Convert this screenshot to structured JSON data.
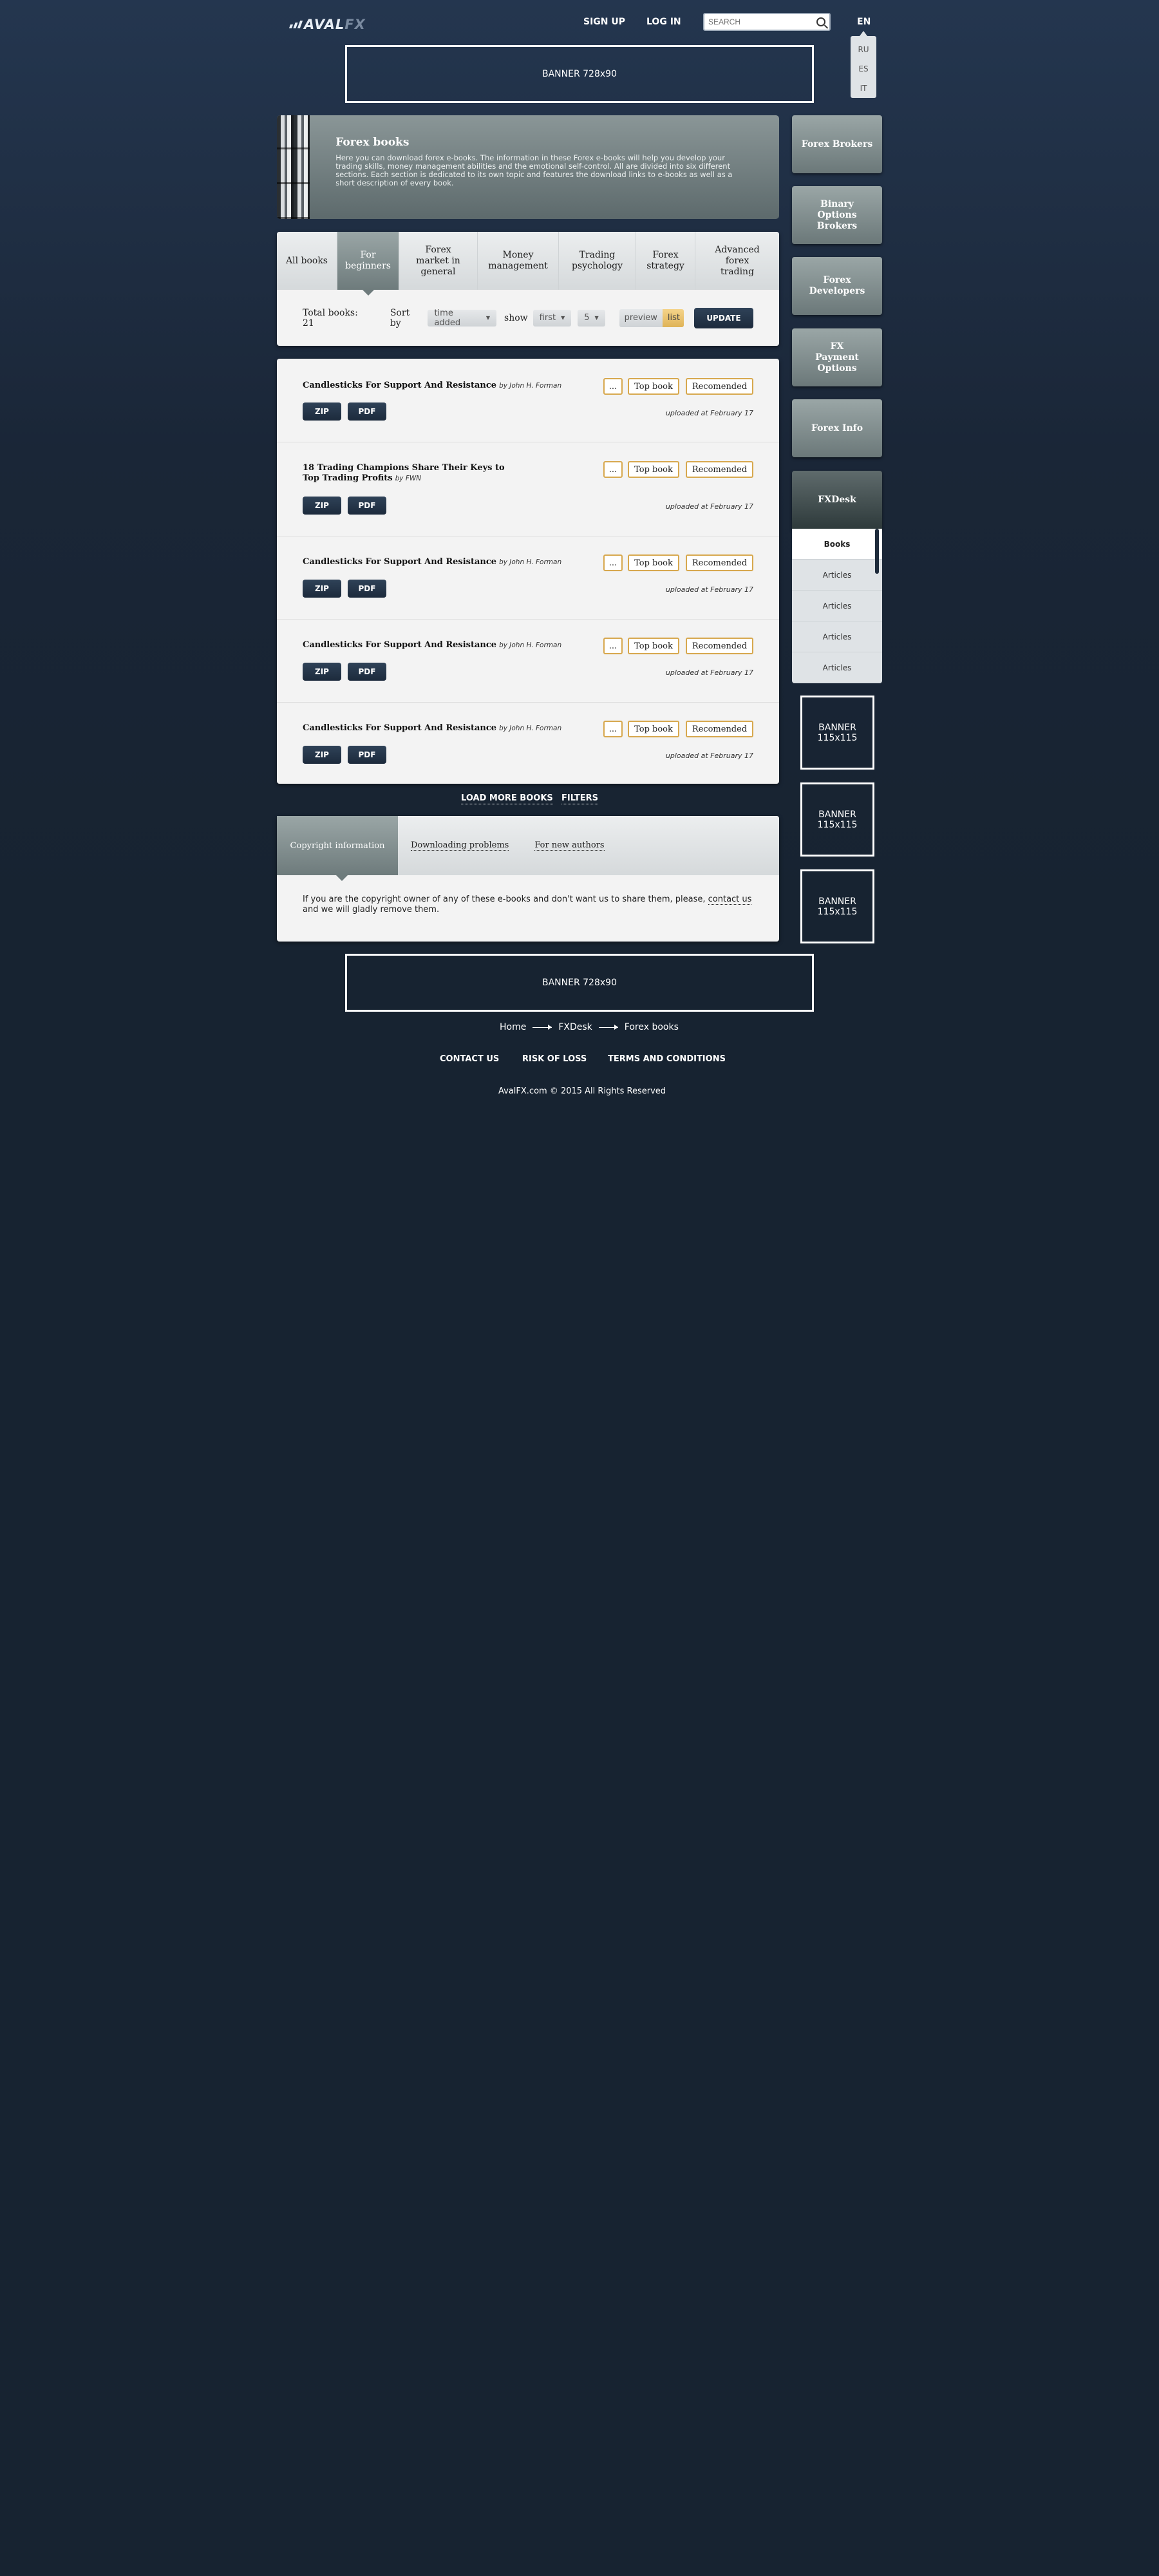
{
  "header": {
    "logo": {
      "main": "AVAL",
      "accent": "FX"
    },
    "signup": "SIGN UP",
    "login": "LOG IN",
    "search_placeholder": "SEARCH",
    "lang_current": "EN",
    "lang_options": [
      "RU",
      "ES",
      "IT"
    ]
  },
  "banners": {
    "top": "BANNER 728x90",
    "bottom": "BANNER 728x90",
    "side": [
      "BANNER\n115x115",
      "BANNER\n115x115",
      "BANNER\n115x115"
    ]
  },
  "hero": {
    "title": "Forex books",
    "text": "Here you can download forex e-books. The information in these Forex e-books will help you develop your trading skills, money management abilities and the emotional self-control. All are divided into six different sections. Each section is dedicated to its own topic and features the download links to e-books as well as a short description of every book."
  },
  "categories": [
    {
      "label": "All books",
      "active": false
    },
    {
      "label": "For beginners",
      "active": true
    },
    {
      "label": "Forex market in general",
      "active": false
    },
    {
      "label": "Money management",
      "active": false
    },
    {
      "label": "Trading psychology",
      "active": false
    },
    {
      "label": "Forex strategy",
      "active": false
    },
    {
      "label": "Advanced forex trading",
      "active": false
    }
  ],
  "controls": {
    "total_label": "Total books: 21",
    "sort_label": "Sort by",
    "sort_value": "time added",
    "show_label": "show",
    "order_value": "first",
    "count_value": "5",
    "view_preview": "preview",
    "view_list": "list",
    "update": "UPDATE"
  },
  "books": [
    {
      "title": "Candlesticks For Support And Resistance",
      "author": "by John H. Forman",
      "uploaded": "uploaded at February 17"
    },
    {
      "title": "18 Trading Champions Share Their Keys to Top Trading Profits",
      "author": "by FWN",
      "uploaded": "uploaded at February 17"
    },
    {
      "title": "Candlesticks For Support And Resistance",
      "author": "by John H. Forman",
      "uploaded": "uploaded at February 17"
    },
    {
      "title": "Candlesticks For Support And Resistance",
      "author": "by John H. Forman",
      "uploaded": "uploaded at February 17"
    },
    {
      "title": "Candlesticks For Support And Resistance",
      "author": "by John H. Forman",
      "uploaded": "uploaded at February 17"
    }
  ],
  "book_labels": {
    "zip": "ZIP",
    "pdf": "PDF",
    "more": "...",
    "top": "Top book",
    "rec": "Recomended"
  },
  "load_more": "LOAD MORE BOOKS",
  "filters": "FILTERS",
  "info_tabs": [
    "Copyright information",
    "Downloading problems",
    "For new authors"
  ],
  "copyright_text": "If you are the copyright owner of any of these e-books and don't want us to share them, please,",
  "copyright_link": "contact us",
  "copyright_text2": "and we will gladly remove them.",
  "sidebar": {
    "items": [
      "Forex Brokers",
      "Binary Options Brokers",
      "Forex Developers",
      "FX Payment Options",
      "Forex Info",
      "FXDesk"
    ],
    "submenu": [
      "Books",
      "Articles",
      "Articles",
      "Articles",
      "Articles"
    ]
  },
  "breadcrumb": [
    "Home",
    "FXDesk",
    "Forex books"
  ],
  "footer": {
    "links": [
      "CONTACT US",
      "RISK OF LOSS",
      "TERMS AND CONDITIONS"
    ],
    "copyright": "AvalFX.com © 2015 All Rights Reserved"
  }
}
